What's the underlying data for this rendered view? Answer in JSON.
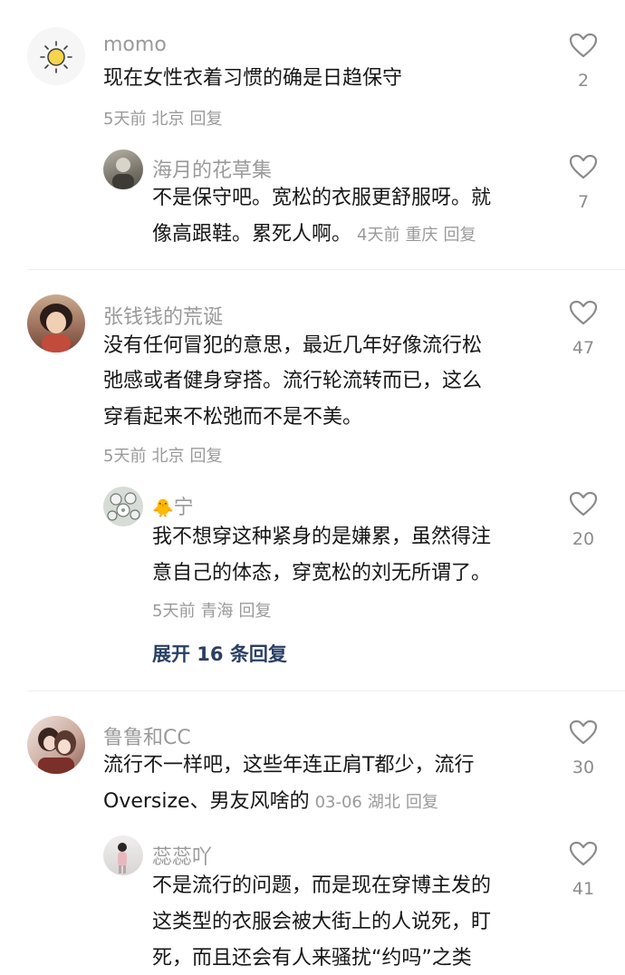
{
  "comments": [
    {
      "user": "momo",
      "lines": [
        "现在女性衣着习惯的确是日趋保守"
      ],
      "time": "5天前",
      "location": "北京",
      "reply": "回复",
      "likes": "2",
      "avatar_icon": "sun-icon"
    },
    {
      "user": "海月的花草集",
      "lines": [
        "不是保守吧。宽松的衣服更舒服呀。就",
        "像高跟鞋。累死人啊。"
      ],
      "time": "4天前",
      "location": "重庆",
      "reply": "回复",
      "likes": "7",
      "avatar_icon": "photo-avatar"
    },
    {
      "user": "张钱钱的荒诞",
      "lines": [
        "没有任何冒犯的意思，最近几年好像流行松",
        "弛感或者健身穿搭。流行轮流转而已，这么",
        "穿看起来不松弛而不是不美。"
      ],
      "time": "5天前",
      "location": "北京",
      "reply": "回复",
      "likes": "47",
      "avatar_icon": "cartoon-avatar"
    },
    {
      "user_emoji": "🐥",
      "user": "宁",
      "lines": [
        "我不想穿这种紧身的是嫌累，虽然得注",
        "意自己的体态，穿宽松的刘无所谓了。"
      ],
      "time": "5天前",
      "location": "青海",
      "reply": "回复",
      "likes": "20",
      "avatar_icon": "flower-avatar",
      "expand": "展开 16 条回复"
    },
    {
      "user": "鲁鲁和CC",
      "lines": [
        "流行不一样吧，这些年连正肩T都少，流行",
        "Oversize、男友风啥的"
      ],
      "time": "03-06",
      "location": "湖北",
      "reply": "回复",
      "likes": "30",
      "avatar_icon": "couple-avatar"
    },
    {
      "user": "蕊蕊吖",
      "lines": [
        "不是流行的问题，而是现在穿博主发的",
        "这类型的衣服会被大街上的人说死，盯",
        "死，而且还会有人来骚扰“约吗”之类"
      ],
      "likes": "41",
      "avatar_icon": "photo-avatar"
    }
  ]
}
